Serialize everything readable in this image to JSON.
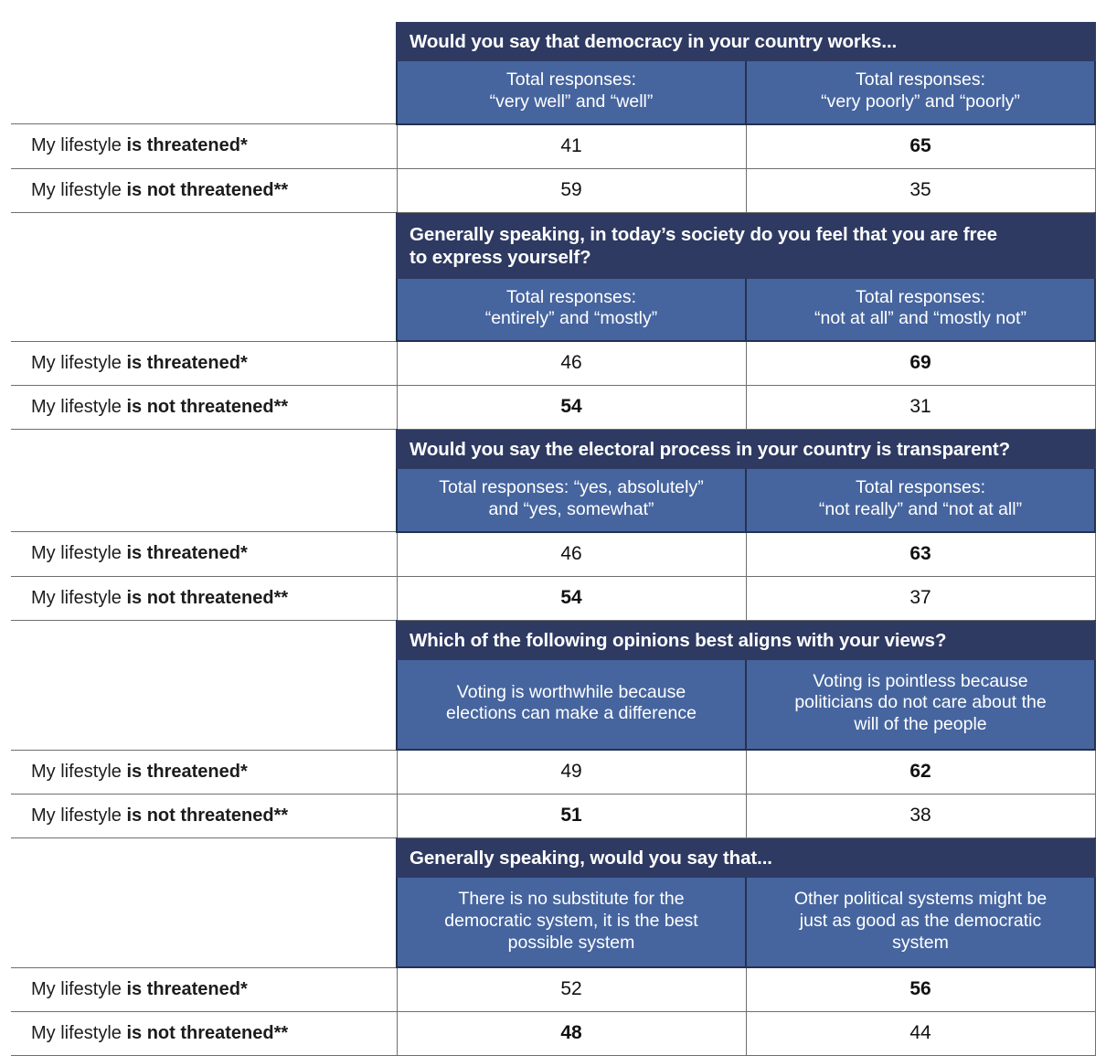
{
  "meta": {
    "row_label_threatened": "My lifestyle is threatened*",
    "row_label_threatened_plain": "My lifestyle ",
    "row_label_threatened_bold": "is threatened*",
    "row_label_not_threatened_plain": "My lifestyle ",
    "row_label_not_threatened_bold": "is not threatened**"
  },
  "colors": {
    "question_header_bg": "#2e3a62",
    "subheader_bg": "#46659f",
    "header_text": "#ffffff",
    "grid_line": "#6e6e6e",
    "body_text": "#111111"
  },
  "chart_data": {
    "type": "table",
    "title": "",
    "row_categories": [
      "My lifestyle is threatened*",
      "My lifestyle is not threatened**"
    ],
    "blocks": [
      {
        "question": "Would you say that democracy in your country works...",
        "columns": [
          "Total responses: “very well” and “well”",
          "Total responses: “very poorly” and “poorly”"
        ],
        "values": [
          [
            41,
            65
          ],
          [
            59,
            35
          ]
        ],
        "bold": [
          [
            false,
            true
          ],
          [
            false,
            false
          ]
        ]
      },
      {
        "question": "Generally speaking, in today’s society do you feel that you are free to express yourself?",
        "columns": [
          "Total responses: “entirely” and “mostly”",
          "Total responses: “not at all” and “mostly not”"
        ],
        "values": [
          [
            46,
            69
          ],
          [
            54,
            31
          ]
        ],
        "bold": [
          [
            false,
            true
          ],
          [
            true,
            false
          ]
        ]
      },
      {
        "question": "Would you say the electoral process in your country is transparent?",
        "columns": [
          "Total responses: “yes, absolutely” and “yes, somewhat”",
          "Total responses: “not really” and “not at all”"
        ],
        "values": [
          [
            46,
            63
          ],
          [
            54,
            37
          ]
        ],
        "bold": [
          [
            false,
            true
          ],
          [
            true,
            false
          ]
        ]
      },
      {
        "question": "Which of the following opinions best aligns with your views?",
        "columns": [
          "Voting is worthwhile because elections can make a difference",
          "Voting is pointless because politicians do not care about the will of the people"
        ],
        "values": [
          [
            49,
            62
          ],
          [
            51,
            38
          ]
        ],
        "bold": [
          [
            false,
            true
          ],
          [
            true,
            false
          ]
        ]
      },
      {
        "question": "Generally speaking, would you say that...",
        "columns": [
          "There is no substitute for the democratic system, it is the best possible system",
          "Other political systems might be just as good as the democratic system"
        ],
        "values": [
          [
            52,
            56
          ],
          [
            48,
            44
          ]
        ],
        "bold": [
          [
            false,
            true
          ],
          [
            true,
            false
          ]
        ]
      }
    ]
  },
  "blocks": [
    {
      "question": "Would you say that democracy in your country works...",
      "question_lines": [
        "Would you say that democracy in your country works..."
      ],
      "col_a_lines": [
        "Total responses:",
        "“very well” and “well”"
      ],
      "col_b_lines": [
        "Total responses:",
        "“very poorly” and “poorly”"
      ],
      "rows": [
        {
          "a": "41",
          "b": "65"
        },
        {
          "a": "59",
          "b": "35"
        }
      ]
    },
    {
      "question": "Generally speaking, in today’s society do you feel that you are free to express yourself?",
      "question_lines": [
        "Generally speaking, in today’s society do you feel that you are free",
        "to express yourself?"
      ],
      "col_a_lines": [
        "Total responses:",
        "“entirely” and “mostly”"
      ],
      "col_b_lines": [
        "Total responses:",
        "“not at all” and “mostly not”"
      ],
      "rows": [
        {
          "a": "46",
          "b": "69"
        },
        {
          "a": "54",
          "b": "31"
        }
      ]
    },
    {
      "question": "Would you say the electoral process in your country is transparent?",
      "question_lines": [
        "Would you say the electoral process in your country is transparent?"
      ],
      "col_a_lines": [
        "Total responses: “yes, absolutely”",
        "and “yes, somewhat”"
      ],
      "col_b_lines": [
        "Total responses:",
        "“not really” and “not at all”"
      ],
      "rows": [
        {
          "a": "46",
          "b": "63"
        },
        {
          "a": "54",
          "b": "37"
        }
      ]
    },
    {
      "question": "Which of the following opinions best aligns with your views?",
      "question_lines": [
        "Which of the following opinions best aligns with your views?"
      ],
      "col_a_lines": [
        "Voting is worthwhile because",
        "elections can make a difference"
      ],
      "col_b_lines": [
        "Voting is pointless because",
        "politicians do not care about the",
        "will of the people"
      ],
      "rows": [
        {
          "a": "49",
          "b": "62"
        },
        {
          "a": "51",
          "b": "38"
        }
      ]
    },
    {
      "question": "Generally speaking, would you say that...",
      "question_lines": [
        "Generally speaking, would you say that..."
      ],
      "col_a_lines": [
        "There is no substitute for the",
        "democratic system, it is the best",
        "possible system"
      ],
      "col_b_lines": [
        "Other political systems might be",
        "just as good as the democratic",
        "system"
      ],
      "rows": [
        {
          "a": "52",
          "b": "56"
        },
        {
          "a": "48",
          "b": "44"
        }
      ]
    }
  ]
}
